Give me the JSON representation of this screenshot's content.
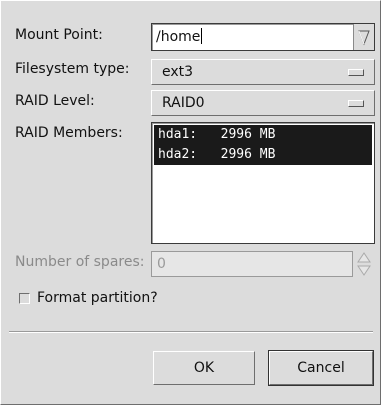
{
  "labels": {
    "mount_point": "Mount Point:",
    "filesystem_type": "Filesystem type:",
    "raid_level": "RAID Level:",
    "raid_members": "RAID Members:",
    "number_of_spares": "Number of spares:",
    "format_partition": "Format partition?"
  },
  "mount_point": {
    "value": "/home"
  },
  "filesystem_type": {
    "selected": "ext3"
  },
  "raid_level": {
    "selected": "RAID0"
  },
  "raid_members": [
    {
      "device": "hda1:",
      "size": "2996 MB"
    },
    {
      "device": "hda2:",
      "size": "2996 MB"
    }
  ],
  "spares": {
    "value": "0"
  },
  "format_partition": {
    "checked": false
  },
  "buttons": {
    "ok": "OK",
    "cancel": "Cancel"
  }
}
